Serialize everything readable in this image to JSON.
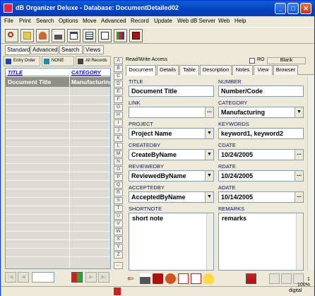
{
  "window": {
    "title": "dB Organizer Deluxe - Database: DocumentDetailed02",
    "min": "_",
    "max": "□",
    "close": "✕"
  },
  "menu": [
    "File",
    "Print",
    "Search",
    "Options",
    "Move",
    "Advanced",
    "Record",
    "Update",
    "Web dB Server",
    "Web",
    "Help"
  ],
  "toolbar_icons": [
    "search-icon",
    "open-icon",
    "people-icon",
    "print-icon",
    "form-view-icon",
    "table-view-icon",
    "document-icon",
    "chart-icon",
    "calculator-icon"
  ],
  "left_tabs": [
    "Standard",
    "Advanced",
    "Search",
    "Views"
  ],
  "left_buttons": {
    "entry_order": "Entry Order",
    "none": "NONE",
    "all_records": "All Records"
  },
  "grid": {
    "columns": [
      "TITLE",
      "CATEGORY"
    ],
    "selected_row": [
      "Document Title",
      "Manufacturing"
    ]
  },
  "letters": [
    "A",
    "B",
    "C",
    "D",
    "E",
    "F",
    "G",
    "H",
    "I",
    "J",
    "K",
    "L",
    "M",
    "N",
    "O",
    "P",
    "Q",
    "R",
    "S",
    "T",
    "U",
    "V",
    "W",
    "X",
    "Y",
    "Z"
  ],
  "access": {
    "label": "Read/Write Access",
    "ro": "RO",
    "blank": "Blank"
  },
  "right_tabs": [
    "Document",
    "Details",
    "Table",
    "Description",
    "Notes",
    "View",
    "Browser"
  ],
  "form": {
    "title_label": "TITLE",
    "title_value": "Document Title",
    "number_label": "NUMBER",
    "number_value": "Number/Code",
    "link_label": "LINK",
    "link_value": "",
    "category_label": "CATEGORY",
    "category_value": "Manufacturing",
    "project_label": "PROJECT",
    "project_value": "Project Name",
    "keywords_label": "KEYWORDS",
    "keywords_value": "keyword1, keyword2",
    "createdby_label": "CREATEDBY",
    "createdby_value": "CreateByName",
    "cdate_label": "CDATE",
    "cdate_value": "10/24/2005",
    "reviewedby_label": "REVIEWEDBY",
    "reviewedby_value": "ReviewedByName",
    "rdate_label": "RDATE",
    "rdate_value": "10/24/2005",
    "acceptedby_label": "ACCEPTEDBY",
    "acceptedby_value": "AcceptedByName",
    "adate_label": "ADATE",
    "adate_value": "10/14/2005",
    "shortnote_label": "SHORTNOTE",
    "shortnote_value": "short note",
    "remarks_label": "REMARKS",
    "remarks_value": "remarks",
    "ellipsis": "...",
    "dropdown": "▼"
  },
  "status": {
    "record": "1",
    "zoom": "100%",
    "mode": "digital"
  },
  "colors": {
    "titlebar": "#0542c0",
    "accent": "#10107a",
    "selected_row": "#8f8f88"
  }
}
